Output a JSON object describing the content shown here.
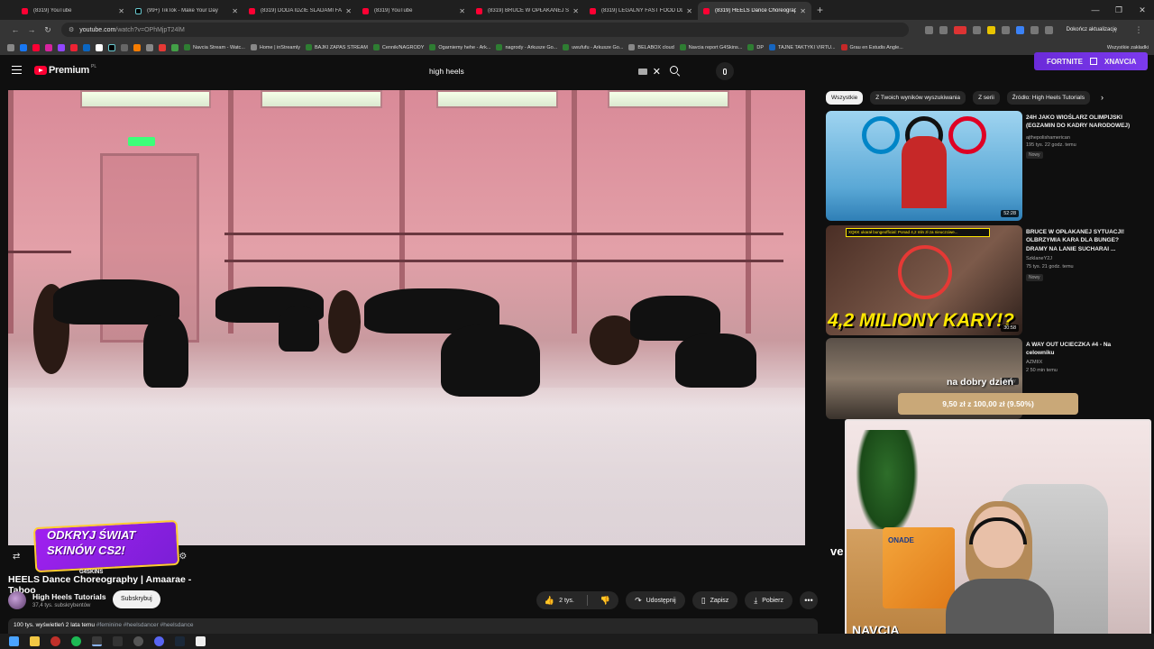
{
  "browser": {
    "tabs": [
      {
        "title": "(8319) YouTube",
        "icon": "youtube-favicon",
        "active": false
      },
      {
        "title": "(99+) TikTok - Make Your Day",
        "icon": "tiktok-favicon",
        "active": false
      },
      {
        "title": "(8319) DODA IDZIE ŚLADAMI FAG...",
        "icon": "youtube-favicon",
        "active": false
      },
      {
        "title": "(8319) YouTube",
        "icon": "youtube-favicon",
        "active": false
      },
      {
        "title": "(8319) BRUCE W OPŁAKANEJ SYT...",
        "icon": "youtube-favicon",
        "active": false
      },
      {
        "title": "(8319) LEGALNY FAST FOOD DLA...",
        "icon": "youtube-favicon",
        "active": false
      },
      {
        "title": "(8319) HEELS Dance Choreograp...",
        "icon": "youtube-favicon",
        "active": true
      }
    ],
    "new_tab": "+",
    "url_host": "youtube.com",
    "url_path": "/watch?v=OPhMjpT24lM",
    "update_label": "Dokończ aktualizację",
    "bookmarks": [
      {
        "label": "Navcia Stream - Watc...",
        "color": "#2e7d32"
      },
      {
        "label": "Home | inStreamly",
        "color": "#444"
      },
      {
        "label": "BAJKI ZAPAS STREAM",
        "color": "#2e7d32"
      },
      {
        "label": "Cennik/NAGRODY",
        "color": "#2e7d32"
      },
      {
        "label": "Ogarniemy hehe - Ark...",
        "color": "#2e7d32"
      },
      {
        "label": "nagrody - Arkusze Go...",
        "color": "#2e7d32"
      },
      {
        "label": "uwufufu - Arkusze Go...",
        "color": "#2e7d32"
      },
      {
        "label": "BELABOX cloud",
        "color": "#888"
      },
      {
        "label": "Navcia report G4Skins...",
        "color": "#2e7d32"
      },
      {
        "label": "DP",
        "color": "#2e7d32"
      },
      {
        "label": "TAJNE TAKTYKI VIRTU...",
        "color": "#1565c0"
      },
      {
        "label": "Grau en Estudis Angle...",
        "color": "#c62828"
      }
    ],
    "bookmarks_all": "Wszystkie zakładki"
  },
  "youtube": {
    "logo_text": "Premium",
    "logo_country": "PL",
    "search_value": "high heels",
    "fortnite_label": "FORTNITE",
    "xnavcia_label": "XNAVCIA",
    "video": {
      "title": "HEELS Dance Choreography | Amaarae - Taboo",
      "channel": "High Heels Tutorials",
      "subscribers": "37,4 tys. subskrybentów",
      "subscribe": "Subskrybuj",
      "likes": "2 tys.",
      "share": "Udostępnij",
      "save": "Zapisz",
      "download": "Pobierz",
      "more": "•••",
      "views_time": "100 tys. wyświetleń  2 lata temu",
      "hashtags": "#feminine #heelsdancer #heelsdance"
    },
    "promo": {
      "line1": "ODKRYJ ŚWIAT",
      "line2": "SKINÓW CS2!",
      "brand": "G4SKINS"
    },
    "chips": [
      "Wszystkie",
      "Z Twoich wyników wyszukiwania",
      "Z serii",
      "Źródło: High Heels Tutorials"
    ],
    "recommendations": [
      {
        "title": "24H JAKO WIOŚLARZ OLIMPIJSKI (EGZAMIN DO KADRY NARODOWEJ)",
        "channel": "ajthepolishamerican",
        "meta": "195 tys.  22 godz. temu",
        "badge": "Nowy",
        "duration": "52:28"
      },
      {
        "title": "BRUCE W OPŁAKANEJ SYTUACJI! OLBRZYMIA KARA DLA BUNGE? DRAMY NA LANIE SUCHARAI ...",
        "channel": "SzklaneY2J",
        "meta": "75 tys.  21 godz. temu",
        "badge": "Nowy",
        "duration": "30:58",
        "thumb_text": "4,2 MILIONY KARY!?",
        "thumb_banner": "XQKK ukarał bungeofficial: Ponad 4,2 mln zł za nieuczciwe..."
      },
      {
        "title": "A WAY OUT UCIECZKA #4 - Na celowniku",
        "channel": "AZMIIX",
        "meta": "2  50 min temu",
        "badge": "Nowy"
      }
    ]
  },
  "overlay": {
    "donation": "9,50 zł z 100,00 zł (9.50%)",
    "donation_progress": 0.095,
    "greeting": "na dobry dzień",
    "cam_brand": "NAVCIA",
    "cam_box_text": "ONADE",
    "ve_text": "ve"
  }
}
